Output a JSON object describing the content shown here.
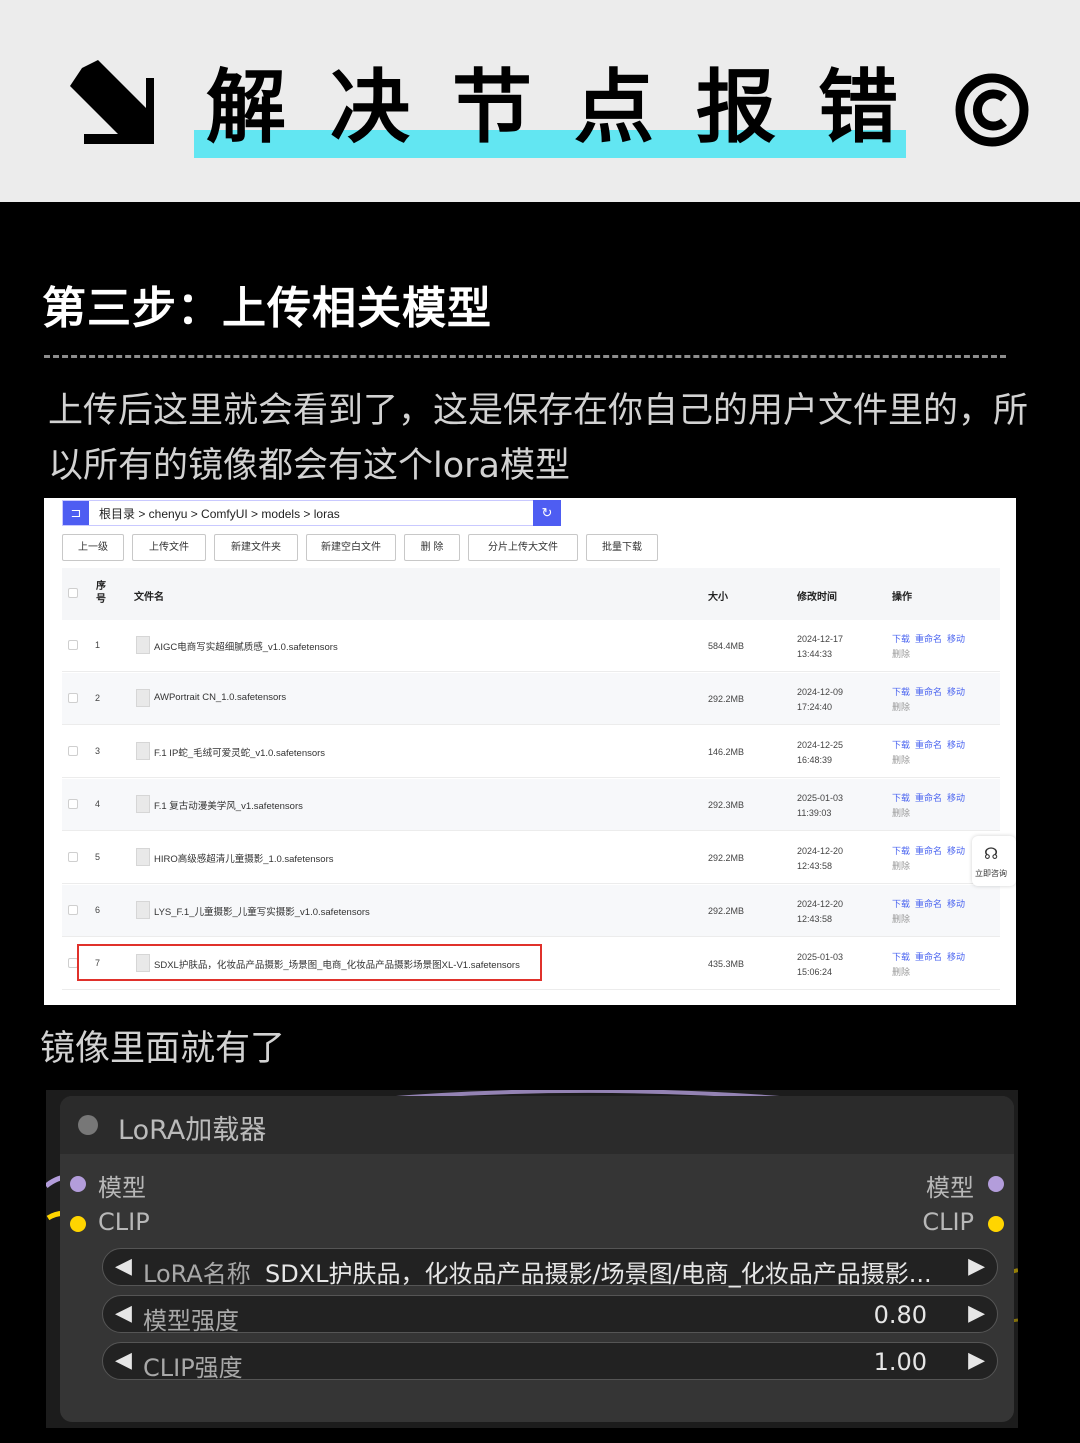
{
  "header": {
    "title_chars": [
      "解",
      "决",
      "节",
      "点",
      "报",
      "错"
    ],
    "highlight_color": "#62e6f2"
  },
  "section": {
    "title": "第三步：上传相关模型",
    "description": "上传后这里就会看到了，这是保存在你自己的用户文件里的，所以所有的镜像都会有这个lora模型",
    "caption": "镜像里面就有了"
  },
  "file_manager": {
    "path": "根目录 > chenyu > ComfyUI > models > loras",
    "toolbar": [
      "上一级",
      "上传文件",
      "新建文件夹",
      "新建空白文件",
      "删 除",
      "分片上传大文件",
      "批量下载"
    ],
    "columns": {
      "seq": "序号",
      "name": "文件名",
      "size": "大小",
      "mtime": "修改时间",
      "ops": "操作"
    },
    "rows": [
      {
        "n": "1",
        "name": "AIGC电商写实超细腻质感_v1.0.safetensors",
        "size": "584.4MB",
        "date": "2024-12-17",
        "time": "13:44:33"
      },
      {
        "n": "2",
        "name": "AWPortrait CN_1.0.safetensors",
        "size": "292.2MB",
        "date": "2024-12-09",
        "time": "17:24:40"
      },
      {
        "n": "3",
        "name": "F.1 IP蛇_毛绒可爱灵蛇_v1.0.safetensors",
        "size": "146.2MB",
        "date": "2024-12-25",
        "time": "16:48:39"
      },
      {
        "n": "4",
        "name": "F.1 复古动漫美学风_v1.safetensors",
        "size": "292.3MB",
        "date": "2025-01-03",
        "time": "11:39:03"
      },
      {
        "n": "5",
        "name": "HIRO高级感超清儿童摄影_1.0.safetensors",
        "size": "292.2MB",
        "date": "2024-12-20",
        "time": "12:43:58"
      },
      {
        "n": "6",
        "name": "LYS_F.1_儿童摄影_儿童写实摄影_v1.0.safetensors",
        "size": "292.2MB",
        "date": "2024-12-20",
        "time": "12:43:58"
      },
      {
        "n": "7",
        "name": "SDXL护肤品，化妆品产品摄影_场景图_电商_化妆品产品摄影场景图XL-V1.safetensors",
        "size": "435.3MB",
        "date": "2025-01-03",
        "time": "15:06:24"
      }
    ],
    "ops": {
      "download": "下载",
      "rename": "重命名",
      "move": "移动",
      "delete": "删除"
    },
    "float_label": "立即咨询"
  },
  "lora_node": {
    "title": "LoRA加载器",
    "input_model": "模型",
    "input_clip": "CLIP",
    "output_model": "模型",
    "output_clip": "CLIP",
    "lora_name_label": "LoRA名称",
    "lora_name_value": "SDXL护肤品，化妆品产品摄影/场景图/电商_化妆品产品摄影...",
    "model_strength_label": "模型强度",
    "model_strength_value": "0.80",
    "clip_strength_label": "CLIP强度",
    "clip_strength_value": "1.00",
    "colors": {
      "model_pin": "#b39ddb",
      "clip_pin": "#ffd500"
    }
  }
}
